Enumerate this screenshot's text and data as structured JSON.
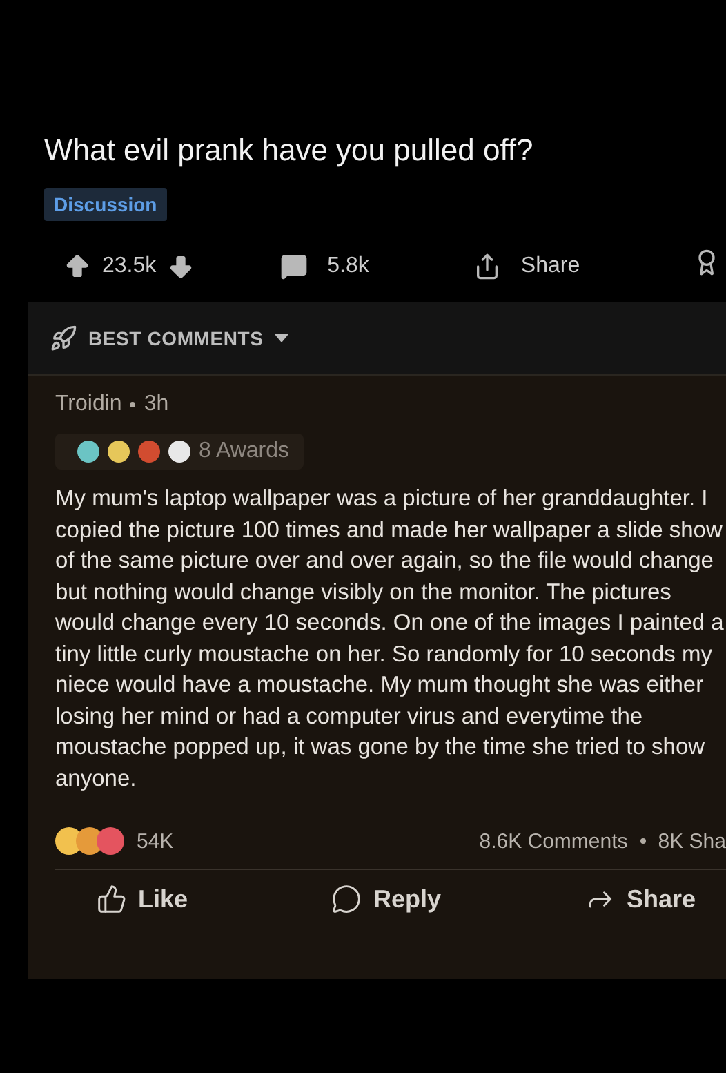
{
  "post": {
    "title": "What evil prank have you pulled off?",
    "flair": "Discussion"
  },
  "actions": {
    "votes": "23.5k",
    "comments": "5.8k",
    "share": "Share"
  },
  "sort": {
    "label": "BEST COMMENTS"
  },
  "comment": {
    "author": "Troidin",
    "time": "3h",
    "awards": "8 Awards",
    "body": "My mum's laptop wallpaper was a picture of her granddaughter. I copied the picture 100 times and made her wallpaper a slide show of the same picture over and over again, so the file would change but nothing would change visibly on the monitor. The pictures would change every 10 seconds. On one of the images I painted a tiny little curly moustache on her. So randomly for 10 seconds my niece would have a moustache. My mum thought she was either losing her mind or had a computer virus and everytime the moustache popped up, it was gone by the time she tried to show anyone."
  },
  "footer": {
    "reactions": "54K",
    "comments": "8.6K Comments",
    "shares": "8K Sha",
    "buttons": [
      "Like",
      "Reply",
      "Share"
    ]
  }
}
